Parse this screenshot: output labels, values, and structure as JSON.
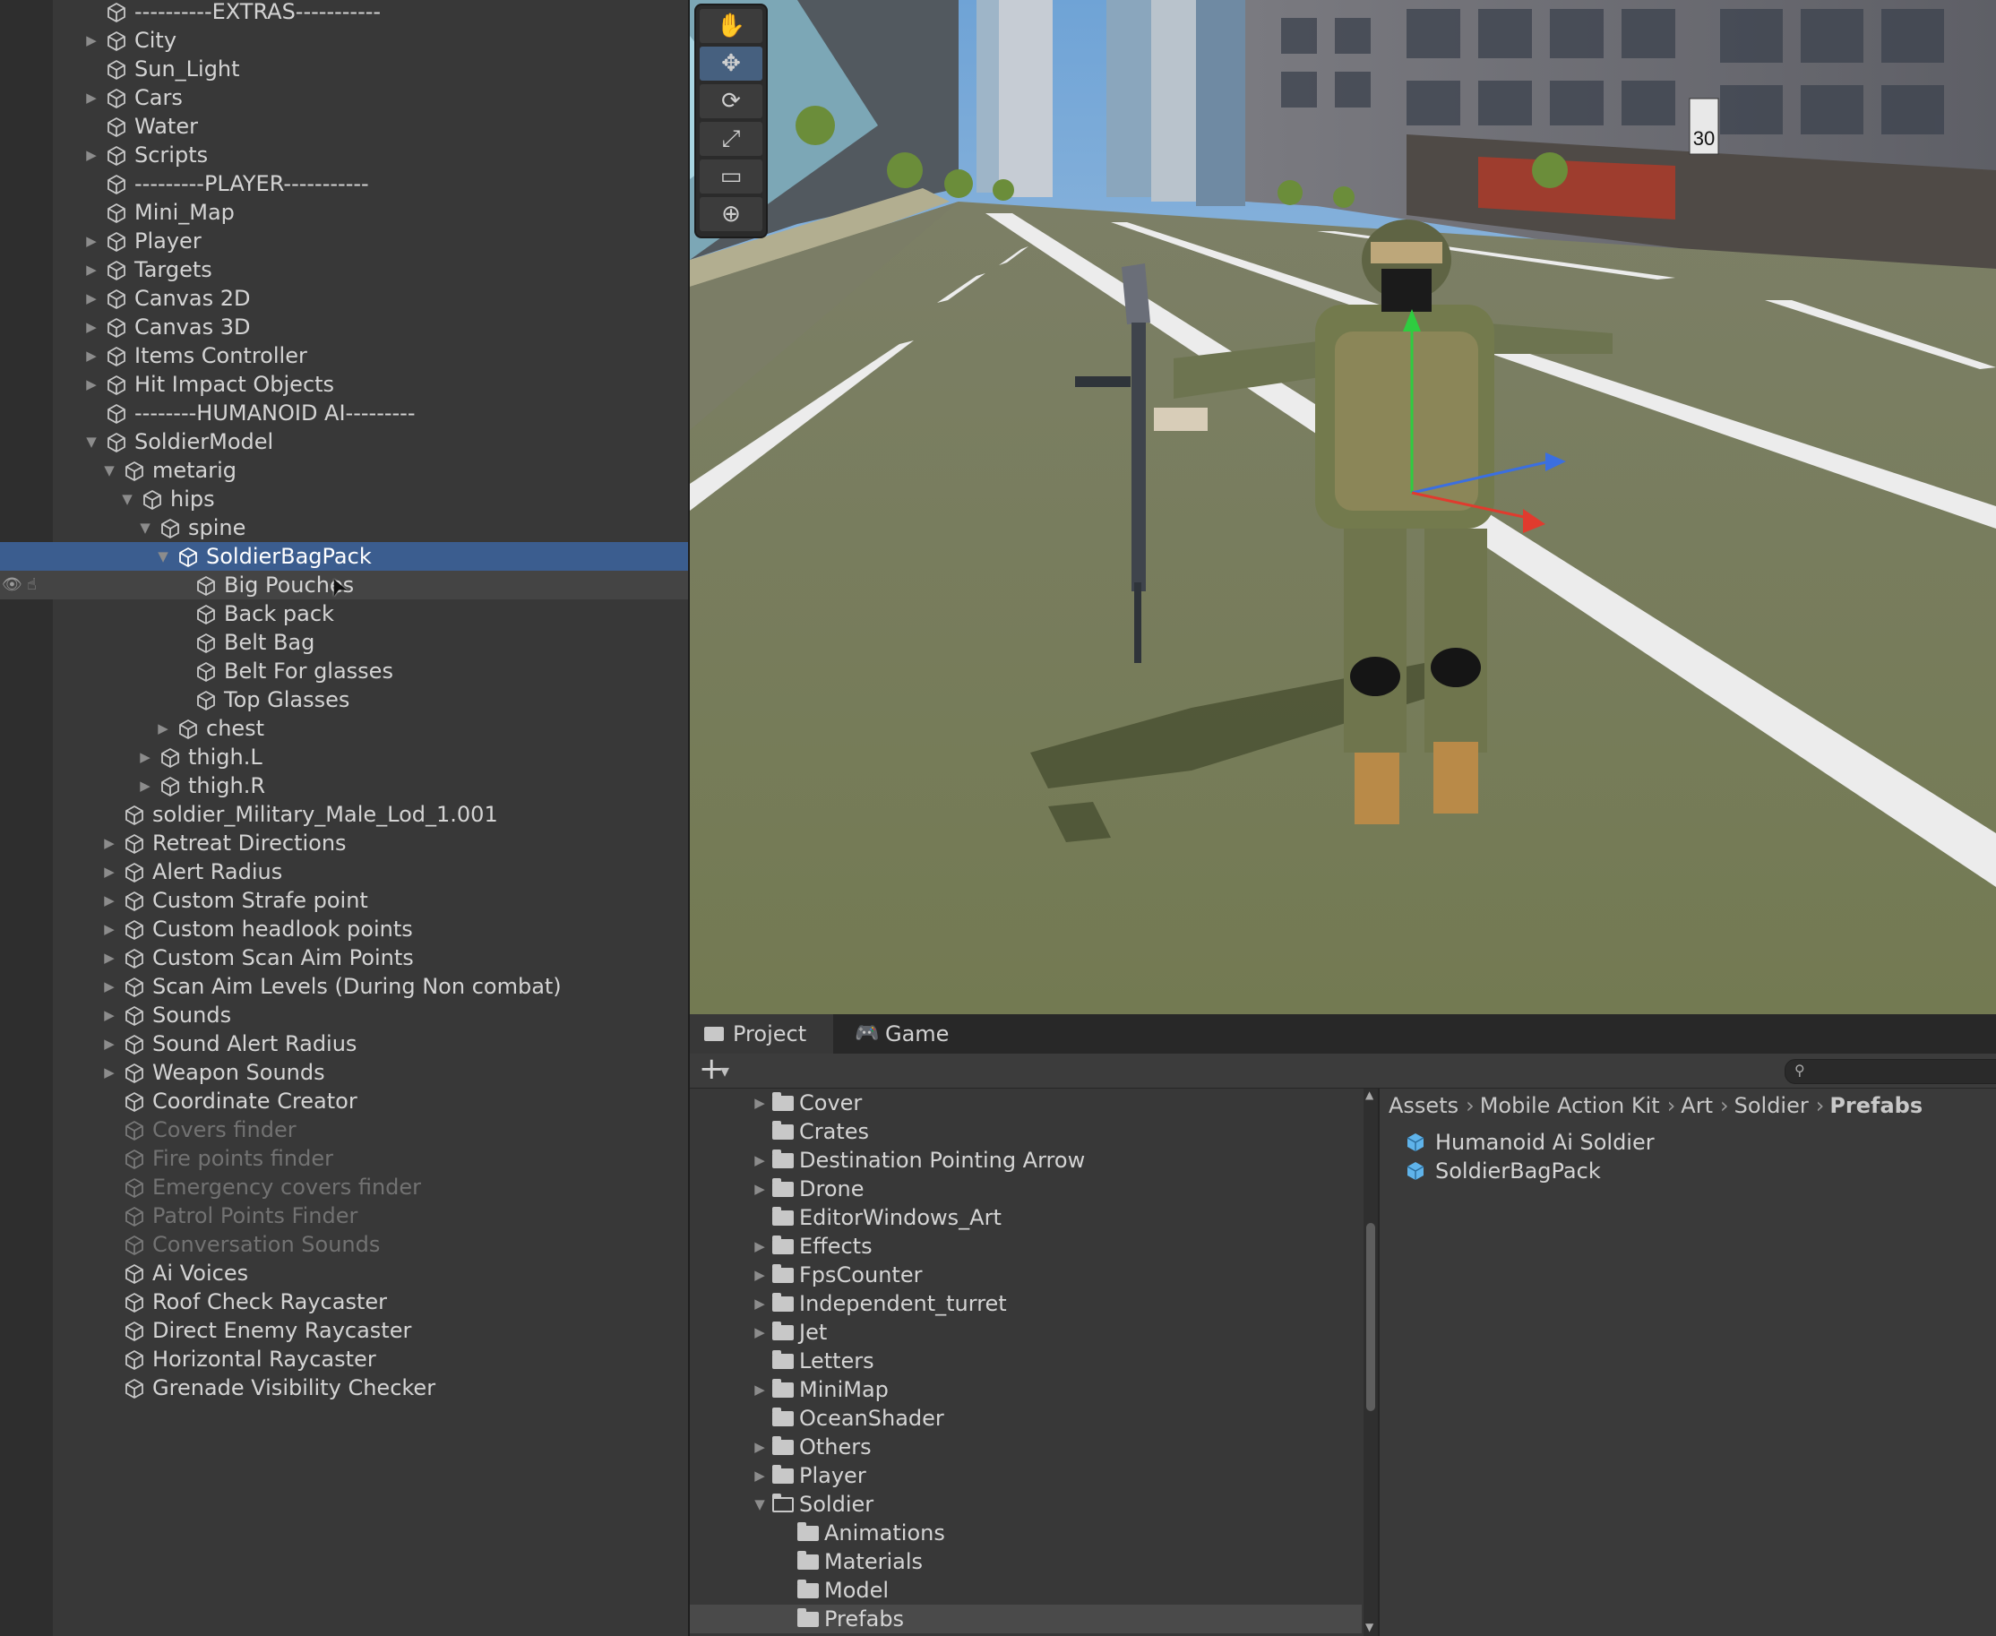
{
  "hierarchy": {
    "items": [
      {
        "label": "----------EXTRAS-----------",
        "depth": 0,
        "expander": "none"
      },
      {
        "label": "City",
        "depth": 0,
        "expander": "collapsed"
      },
      {
        "label": "Sun_Light",
        "depth": 0,
        "expander": "none"
      },
      {
        "label": "Cars",
        "depth": 0,
        "expander": "collapsed"
      },
      {
        "label": "Water",
        "depth": 0,
        "expander": "none"
      },
      {
        "label": "Scripts",
        "depth": 0,
        "expander": "collapsed"
      },
      {
        "label": "---------PLAYER-----------",
        "depth": 0,
        "expander": "none"
      },
      {
        "label": "Mini_Map",
        "depth": 0,
        "expander": "none"
      },
      {
        "label": "Player",
        "depth": 0,
        "expander": "collapsed"
      },
      {
        "label": "Targets",
        "depth": 0,
        "expander": "collapsed"
      },
      {
        "label": "Canvas 2D",
        "depth": 0,
        "expander": "collapsed"
      },
      {
        "label": "Canvas 3D",
        "depth": 0,
        "expander": "collapsed"
      },
      {
        "label": "Items Controller",
        "depth": 0,
        "expander": "collapsed"
      },
      {
        "label": "Hit Impact Objects",
        "depth": 0,
        "expander": "collapsed"
      },
      {
        "label": "--------HUMANOID AI---------",
        "depth": 0,
        "expander": "none"
      },
      {
        "label": "SoldierModel",
        "depth": 0,
        "expander": "expanded"
      },
      {
        "label": "metarig",
        "depth": 1,
        "expander": "expanded"
      },
      {
        "label": "hips",
        "depth": 2,
        "expander": "expanded"
      },
      {
        "label": "spine",
        "depth": 3,
        "expander": "expanded"
      },
      {
        "label": "SoldierBagPack",
        "depth": 4,
        "expander": "expanded",
        "state": "selected"
      },
      {
        "label": "Big Pouches",
        "depth": 5,
        "expander": "none",
        "state": "hover"
      },
      {
        "label": "Back pack",
        "depth": 5,
        "expander": "none"
      },
      {
        "label": "Belt Bag",
        "depth": 5,
        "expander": "none"
      },
      {
        "label": "Belt For glasses",
        "depth": 5,
        "expander": "none"
      },
      {
        "label": "Top Glasses",
        "depth": 5,
        "expander": "none"
      },
      {
        "label": "chest",
        "depth": 4,
        "expander": "collapsed"
      },
      {
        "label": "thigh.L",
        "depth": 3,
        "expander": "collapsed"
      },
      {
        "label": "thigh.R",
        "depth": 3,
        "expander": "collapsed"
      },
      {
        "label": "soldier_Military_Male_Lod_1.001",
        "depth": 1,
        "expander": "none"
      },
      {
        "label": "Retreat Directions",
        "depth": 1,
        "expander": "collapsed"
      },
      {
        "label": "Alert Radius",
        "depth": 1,
        "expander": "collapsed"
      },
      {
        "label": "Custom Strafe point",
        "depth": 1,
        "expander": "collapsed"
      },
      {
        "label": "Custom headlook points",
        "depth": 1,
        "expander": "collapsed"
      },
      {
        "label": "Custom Scan Aim Points",
        "depth": 1,
        "expander": "collapsed"
      },
      {
        "label": "Scan Aim Levels (During Non combat)",
        "depth": 1,
        "expander": "collapsed"
      },
      {
        "label": "Sounds",
        "depth": 1,
        "expander": "collapsed"
      },
      {
        "label": "Sound Alert Radius",
        "depth": 1,
        "expander": "collapsed"
      },
      {
        "label": "Weapon Sounds",
        "depth": 1,
        "expander": "collapsed"
      },
      {
        "label": "Coordinate Creator",
        "depth": 1,
        "expander": "none"
      },
      {
        "label": "Covers finder",
        "depth": 1,
        "expander": "none",
        "state": "disabled"
      },
      {
        "label": "Fire points finder",
        "depth": 1,
        "expander": "none",
        "state": "disabled"
      },
      {
        "label": "Emergency covers finder",
        "depth": 1,
        "expander": "none",
        "state": "disabled"
      },
      {
        "label": "Patrol Points Finder",
        "depth": 1,
        "expander": "none",
        "state": "disabled"
      },
      {
        "label": "Conversation Sounds",
        "depth": 1,
        "expander": "none",
        "state": "disabled"
      },
      {
        "label": "Ai Voices",
        "depth": 1,
        "expander": "none"
      },
      {
        "label": "Roof Check Raycaster",
        "depth": 1,
        "expander": "none"
      },
      {
        "label": "Direct Enemy Raycaster",
        "depth": 1,
        "expander": "none"
      },
      {
        "label": "Horizontal Raycaster",
        "depth": 1,
        "expander": "none"
      },
      {
        "label": "Grenade Visibility Checker",
        "depth": 1,
        "expander": "none"
      }
    ]
  },
  "scene": {
    "tools": [
      {
        "name": "hand-tool",
        "glyph": "✋",
        "active": false
      },
      {
        "name": "move-tool",
        "glyph": "✥",
        "active": true
      },
      {
        "name": "rotate-tool",
        "glyph": "⟳",
        "active": false
      },
      {
        "name": "scale-tool",
        "glyph": "⤢",
        "active": false
      },
      {
        "name": "rect-tool",
        "glyph": "▭",
        "active": false
      },
      {
        "name": "transform-tool",
        "glyph": "⊕",
        "active": false
      }
    ],
    "speed_sign": "30"
  },
  "bottom": {
    "tabs": {
      "project": "Project",
      "game": "Game"
    },
    "add_button": "+",
    "add_dropdown": "▾",
    "folders": [
      {
        "label": "Cover",
        "indent": 0,
        "expander": "collapsed"
      },
      {
        "label": "Crates",
        "indent": 0,
        "expander": "none"
      },
      {
        "label": "Destination Pointing Arrow",
        "indent": 0,
        "expander": "collapsed"
      },
      {
        "label": "Drone",
        "indent": 0,
        "expander": "collapsed"
      },
      {
        "label": "EditorWindows_Art",
        "indent": 0,
        "expander": "none"
      },
      {
        "label": "Effects",
        "indent": 0,
        "expander": "collapsed"
      },
      {
        "label": "FpsCounter",
        "indent": 0,
        "expander": "collapsed"
      },
      {
        "label": "Independent_turret",
        "indent": 0,
        "expander": "collapsed"
      },
      {
        "label": "Jet",
        "indent": 0,
        "expander": "collapsed"
      },
      {
        "label": "Letters",
        "indent": 0,
        "expander": "none"
      },
      {
        "label": "MiniMap",
        "indent": 0,
        "expander": "collapsed"
      },
      {
        "label": "OceanShader",
        "indent": 0,
        "expander": "none"
      },
      {
        "label": "Others",
        "indent": 0,
        "expander": "collapsed"
      },
      {
        "label": "Player",
        "indent": 0,
        "expander": "collapsed"
      },
      {
        "label": "Soldier",
        "indent": 0,
        "expander": "expanded"
      },
      {
        "label": "Animations",
        "indent": 1,
        "expander": "none"
      },
      {
        "label": "Materials",
        "indent": 1,
        "expander": "none"
      },
      {
        "label": "Model",
        "indent": 1,
        "expander": "none"
      },
      {
        "label": "Prefabs",
        "indent": 1,
        "expander": "none",
        "state": "selected"
      }
    ],
    "breadcrumb": [
      "Assets",
      "Mobile Action Kit",
      "Art",
      "Soldier",
      "Prefabs"
    ],
    "assets": [
      "Humanoid Ai Soldier",
      "SoldierBagPack"
    ]
  },
  "colors": {
    "selection": "#3b5d8f",
    "panel": "#383838",
    "prefab_blue": "#5fb3ea"
  }
}
